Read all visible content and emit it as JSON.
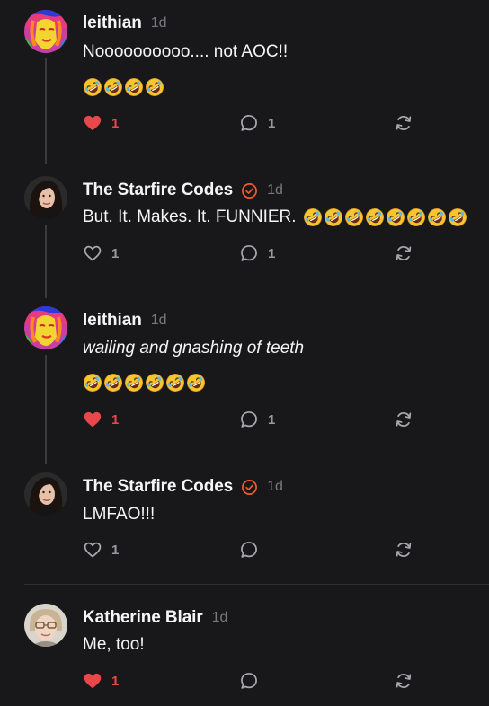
{
  "colors": {
    "background": "#18181a",
    "like_active": "#e8474c",
    "verified": "#ef5a2f",
    "muted": "#7a7a7e"
  },
  "posts": [
    {
      "author": "leithian",
      "time": "1d",
      "verified": false,
      "text": "Noooooooooo.... not AOC!!",
      "italic": false,
      "emoji_count": 4,
      "liked": true,
      "likes": "1",
      "replies": "1"
    },
    {
      "author": "The Starfire Codes",
      "time": "1d",
      "verified": true,
      "text": "But. It. Makes. It. FUNNIER.",
      "italic": false,
      "emoji_count": 8,
      "liked": false,
      "likes": "1",
      "replies": "1"
    },
    {
      "author": "leithian",
      "time": "1d",
      "verified": false,
      "text": "wailing and gnashing of teeth",
      "italic": true,
      "emoji_count": 6,
      "liked": true,
      "likes": "1",
      "replies": "1"
    },
    {
      "author": "The Starfire Codes",
      "time": "1d",
      "verified": true,
      "text": "LMFAO!!!",
      "italic": false,
      "emoji_count": 0,
      "liked": false,
      "likes": "1",
      "replies": ""
    },
    {
      "author": "Katherine Blair",
      "time": "1d",
      "verified": false,
      "text": "Me, too!",
      "italic": false,
      "emoji_count": 0,
      "liked": true,
      "likes": "1",
      "replies": ""
    }
  ],
  "icons": {
    "like": "heart-icon",
    "reply": "comment-bubble-icon",
    "repost": "repost-icon",
    "verified": "verified-check-icon",
    "emoji": "rolling-on-floor-laughing-emoji"
  }
}
